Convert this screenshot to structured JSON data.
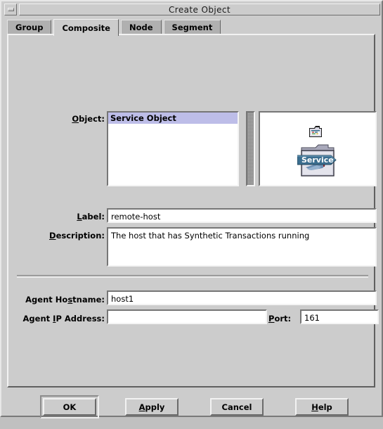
{
  "window": {
    "title": "Create Object",
    "minimize_icon": "minimize-icon"
  },
  "tabs": [
    {
      "label": "Group",
      "active": false
    },
    {
      "label": "Composite",
      "active": true
    },
    {
      "label": "Node",
      "active": false
    },
    {
      "label": "Segment",
      "active": false
    }
  ],
  "form": {
    "object": {
      "label_prefix": "",
      "label_mnemonic": "O",
      "label_suffix": "bject:",
      "items": [
        "Service Object"
      ],
      "selected": "Service Object",
      "selected_index": 0,
      "highlight_color": "#bdbde8"
    },
    "icon_preview": {
      "small_icon_name": "folder-contents-icon",
      "large_icon_name": "service-folder-icon",
      "banner_text": "Service",
      "banner_color": "#3b6e8f",
      "folder_color": "#c9c9d8"
    },
    "label_field": {
      "label_prefix": "",
      "label_mnemonic": "L",
      "label_suffix": "abel:",
      "value": "remote-host",
      "placeholder": ""
    },
    "description_field": {
      "label_prefix": "",
      "label_mnemonic": "D",
      "label_suffix": "escription:",
      "value": "The host that has Synthetic Transactions running",
      "placeholder": ""
    },
    "agent_hostname": {
      "label_prefix": "Agent Ho",
      "label_mnemonic": "s",
      "label_suffix": "tname:",
      "value": "host1",
      "placeholder": ""
    },
    "agent_ip_address": {
      "label_prefix": "Agent ",
      "label_mnemonic": "I",
      "label_suffix": "P Address:",
      "value": "",
      "placeholder": ""
    },
    "port": {
      "label_prefix": "",
      "label_mnemonic": "P",
      "label_suffix": "ort:",
      "value": "161",
      "placeholder": ""
    }
  },
  "buttons": [
    {
      "name": "ok",
      "prefix": "OK",
      "mnemonic": "",
      "suffix": "",
      "default": true
    },
    {
      "name": "apply",
      "prefix": "",
      "mnemonic": "A",
      "suffix": "pply",
      "default": false
    },
    {
      "name": "cancel",
      "prefix": "Cancel",
      "mnemonic": "",
      "suffix": "",
      "default": false
    },
    {
      "name": "help",
      "prefix": "",
      "mnemonic": "H",
      "suffix": "elp",
      "default": false
    }
  ],
  "colors": {
    "background": "#cccccc",
    "tab_inactive": "#b0b0b0",
    "field_background": "#ffffff",
    "selection": "#bdbde8"
  }
}
